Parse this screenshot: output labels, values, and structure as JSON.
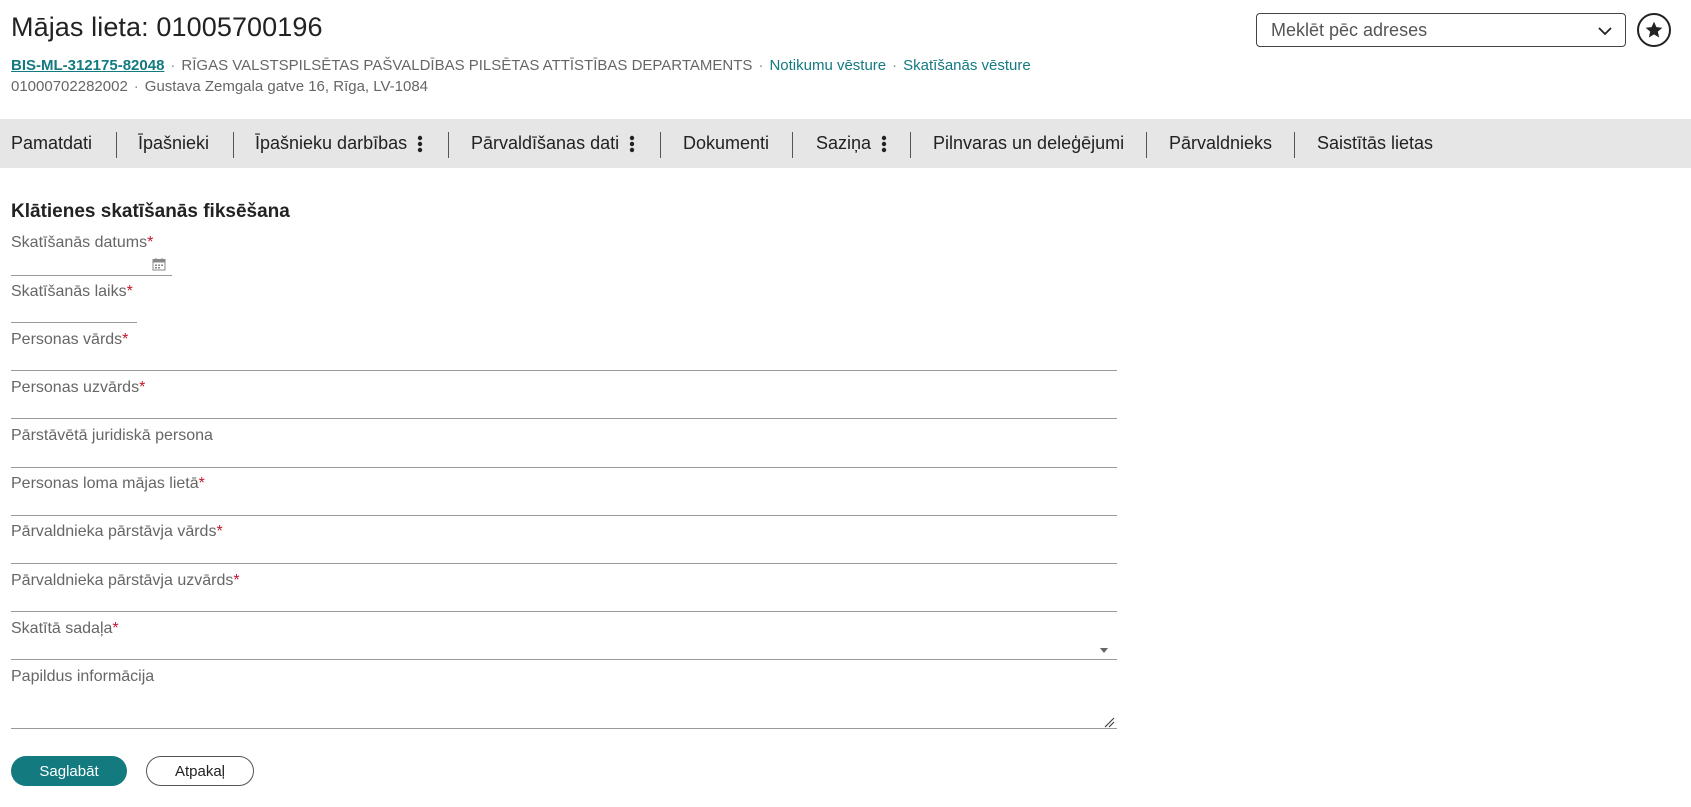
{
  "header": {
    "title": "Mājas lieta: 01005700196",
    "case_id": "BIS-ML-312175-82048",
    "department": "RĪGAS VALSTSPILSĒTAS PAŠVALDĪBAS PILSĒTAS ATTĪSTĪBAS DEPARTAMENTS",
    "separator": "·",
    "event_history_link": "Notikumu vēsture",
    "view_history_link": "Skatīšanās vēsture",
    "cadastre_number": "01000702282002",
    "address": "Gustava Zemgala gatve 16, Rīga, LV-1084"
  },
  "search": {
    "placeholder": "Meklēt pēc adreses",
    "icon": "chevron-down-icon"
  },
  "favorite": {
    "icon": "star-icon"
  },
  "tabs": [
    {
      "label": "Pamatdati",
      "has_menu": false
    },
    {
      "label": "Īpašnieki",
      "has_menu": false
    },
    {
      "label": "Īpašnieku darbības",
      "has_menu": true
    },
    {
      "label": "Pārvaldīšanas dati",
      "has_menu": true
    },
    {
      "label": "Dokumenti",
      "has_menu": false
    },
    {
      "label": "Saziņa",
      "has_menu": true
    },
    {
      "label": "Pilnvaras un deleģējumi",
      "has_menu": false
    },
    {
      "label": "Pārvaldnieks",
      "has_menu": false
    },
    {
      "label": "Saistītās lietas",
      "has_menu": false
    }
  ],
  "form": {
    "title": "Klātienes skatīšanās fiksēšana",
    "required_marker": "*",
    "fields": [
      {
        "label": "Skatīšanās datums",
        "required": true,
        "value": "",
        "type": "date"
      },
      {
        "label": "Skatīšanās laiks",
        "required": true,
        "value": "",
        "type": "time"
      },
      {
        "label": "Personas vārds",
        "required": true,
        "value": "",
        "type": "text"
      },
      {
        "label": "Personas uzvārds",
        "required": true,
        "value": "",
        "type": "text"
      },
      {
        "label": "Pārstāvētā juridiskā persona",
        "required": false,
        "value": "",
        "type": "text"
      },
      {
        "label": "Personas loma mājas lietā",
        "required": true,
        "value": "",
        "type": "text"
      },
      {
        "label": "Pārvaldnieka pārstāvja vārds",
        "required": true,
        "value": "",
        "type": "text"
      },
      {
        "label": "Pārvaldnieka pārstāvja uzvārds",
        "required": true,
        "value": "",
        "type": "text"
      },
      {
        "label": "Skatītā sadaļa",
        "required": true,
        "value": "",
        "type": "select"
      },
      {
        "label": "Papildus informācija",
        "required": false,
        "value": "",
        "type": "textarea"
      }
    ],
    "save_label": "Saglabāt",
    "back_label": "Atpakaļ"
  },
  "colors": {
    "accent": "#137a80",
    "required": "#c0172b",
    "tabbar_bg": "#e6e6e6"
  }
}
